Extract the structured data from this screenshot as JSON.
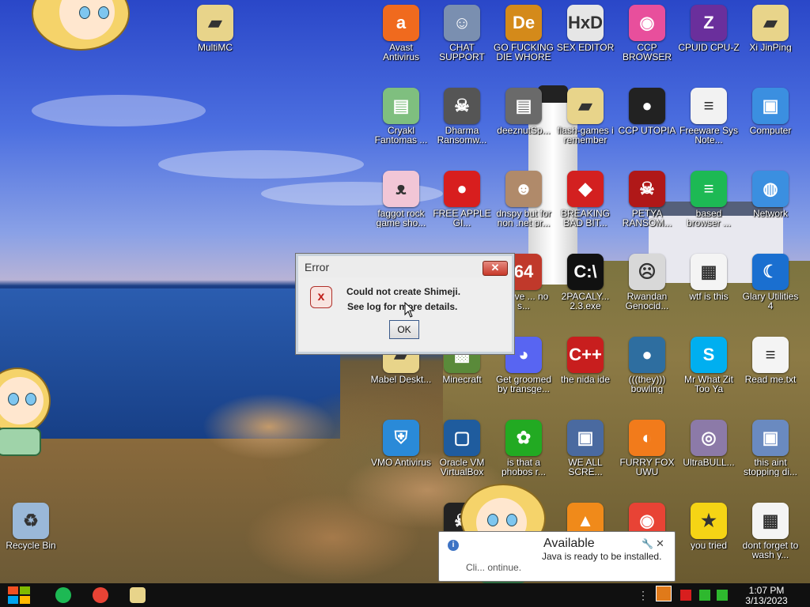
{
  "desktop_icons": [
    {
      "label": "MultiMC",
      "icon": "folder-icon",
      "color": "#e8d48a"
    },
    {
      "label": "Avast Antivirus",
      "icon": "avast-icon",
      "color": "#f06a1e"
    },
    {
      "label": "CHAT SUPPORT",
      "icon": "support-person-icon",
      "color": "#7a8fb0"
    },
    {
      "label": "GO FUCKING DIE WHORE",
      "icon": "de-logo-icon",
      "color": "#d48a1a"
    },
    {
      "label": "SEX EDITOR",
      "icon": "hxd-icon",
      "color": "#e6e6e6"
    },
    {
      "label": "CCP BROWSER",
      "icon": "browser-icon",
      "color": "#e84f9c"
    },
    {
      "label": "CPUID CPU-Z",
      "icon": "cpuz-icon",
      "color": "#6a2f9c"
    },
    {
      "label": "Xi JinPing",
      "icon": "user-folder-icon",
      "color": "#e8d48a"
    },
    {
      "label": "Cryakl Fantomas ...",
      "icon": "window-icon",
      "color": "#7fbf7f"
    },
    {
      "label": "Dharma Ransomw...",
      "icon": "skull-icon",
      "color": "#555555"
    },
    {
      "label": "deeznutSp...",
      "icon": "stack-icon",
      "color": "#6a6a6a"
    },
    {
      "label": "flash-games i remember",
      "icon": "folder-icon",
      "color": "#e8d48a"
    },
    {
      "label": "CCP UTOPIA",
      "icon": "dark-circle-icon",
      "color": "#222222"
    },
    {
      "label": "Freeware Sys Note...",
      "icon": "document-icon",
      "color": "#f2f2f2"
    },
    {
      "label": "Computer",
      "icon": "computer-icon",
      "color": "#3b8fe0"
    },
    {
      "label": "faggot rock game sho...",
      "icon": "pig-icon",
      "color": "#f2c6d6"
    },
    {
      "label": "FREE APPLE GI...",
      "icon": "apple-icon",
      "color": "#d81e1e"
    },
    {
      "label": "dnspy but for non .net pr...",
      "icon": "portrait-icon",
      "color": "#b08a6a"
    },
    {
      "label": "BREAKING BAD BIT...",
      "icon": "angry-bird-icon",
      "color": "#d32020"
    },
    {
      "label": "PETYA RANSOM...",
      "icon": "petya-skull-icon",
      "color": "#b01818"
    },
    {
      "label": "based browser ...",
      "icon": "chat-bubble-icon",
      "color": "#1db954"
    },
    {
      "label": "Network",
      "icon": "network-icon",
      "color": "#3b8fe0"
    },
    {
      "label": "above ... no s...",
      "icon": "app-icon",
      "color": "#c0392b"
    },
    {
      "label": "2PACALY... 2.3.exe",
      "icon": "terminal-icon",
      "color": "#111111"
    },
    {
      "label": "Rwandan Genocid...",
      "icon": "meme-face-icon",
      "color": "#d8d8d8"
    },
    {
      "label": "wtf is this",
      "icon": "calendar-doc-icon",
      "color": "#f4f4f4"
    },
    {
      "label": "Glary Utilities 4",
      "icon": "moon-icon",
      "color": "#1a6fd0"
    },
    {
      "label": "Mabel Deskt...",
      "icon": "folder-icon",
      "color": "#e8d48a"
    },
    {
      "label": "Minecraft",
      "icon": "minecraft-icon",
      "color": "#5a8a3a"
    },
    {
      "label": "Get groomed by transge...",
      "icon": "discord-icon",
      "color": "#5865f2"
    },
    {
      "label": "the nida ide",
      "icon": "devcpp-icon",
      "color": "#c81e1e"
    },
    {
      "label": "(((they))) bowling",
      "icon": "bowling-icon",
      "color": "#2e6ea0"
    },
    {
      "label": "Mr What Zit Too Ya",
      "icon": "skype-icon",
      "color": "#00aff0"
    },
    {
      "label": "Read me.txt",
      "icon": "text-file-icon",
      "color": "#f4f4f4"
    },
    {
      "label": "VMO Antivirus",
      "icon": "shield-icon",
      "color": "#2a8ad8"
    },
    {
      "label": "Oracle VM VirtualBox",
      "icon": "virtualbox-icon",
      "color": "#1f5c9e"
    },
    {
      "label": "is that a phobos r...",
      "icon": "flower-icon",
      "color": "#22aa22"
    },
    {
      "label": "WE ALL SCRE...",
      "icon": "pc-icon",
      "color": "#4a6aa0"
    },
    {
      "label": "FURRY FOX UWU",
      "icon": "firefox-icon",
      "color": "#f27b1b"
    },
    {
      "label": "UltraBULL...",
      "icon": "disc-icon",
      "color": "#8c7aa8"
    },
    {
      "label": "this aint stopping di...",
      "icon": "computer-tools-icon",
      "color": "#6a8ac0"
    },
    {
      "label": "Recycle Bin",
      "icon": "recycle-bin-icon",
      "color": "#9ab8d8"
    },
    {
      "label": "A...",
      "icon": "skull-icon",
      "color": "#222222"
    },
    {
      "label": "",
      "icon": "vlc-icon",
      "color": "#f08a1a"
    },
    {
      "label": "",
      "icon": "chrome-icon",
      "color": "#e84335"
    },
    {
      "label": "you tried",
      "icon": "star-icon",
      "color": "#f5d415"
    },
    {
      "label": "dont forget to wash y...",
      "icon": "calendar-doc-icon",
      "color": "#f4f4f4"
    }
  ],
  "error_dialog": {
    "title": "Error",
    "line1": "Could not create Shimeji.",
    "line2": "See log for more details.",
    "ok_label": "OK",
    "close_glyph": "✕",
    "icon_glyph": "x"
  },
  "java_balloon": {
    "title": "Available",
    "message": "Java is ready to be installed.",
    "hint": "Cli...                     ontinue.",
    "info_glyph": "i",
    "wrench_glyph": "🔧",
    "close_glyph": "✕"
  },
  "taskbar": {
    "pinned": [
      {
        "name": "spotify-icon",
        "color": "#1db954"
      },
      {
        "name": "chrome-icon",
        "color": "#e84335"
      },
      {
        "name": "file-explorer-icon",
        "color": "#e8d48a"
      }
    ],
    "tray": [
      {
        "name": "java-update-icon",
        "color": "#e07a1a"
      },
      {
        "name": "flag-icon",
        "color": "#d81e1e"
      },
      {
        "name": "network-tray-icon",
        "color": "#2eb82e"
      },
      {
        "name": "volume-icon",
        "color": "#2eb82e"
      }
    ],
    "clock": {
      "time": "1:07 PM",
      "date": "3/13/2023"
    },
    "more_glyph": "⋮"
  }
}
